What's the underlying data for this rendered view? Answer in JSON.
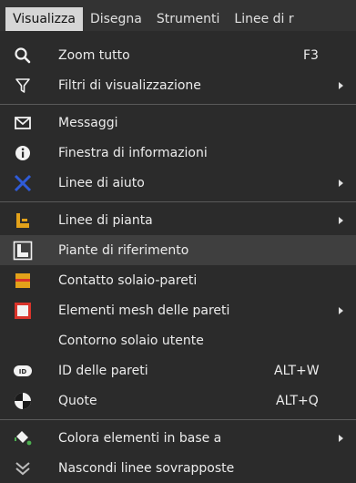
{
  "menubar": {
    "items": [
      "Visualizza",
      "Disegna",
      "Strumenti",
      "Linee di r"
    ]
  },
  "menu": {
    "items": [
      {
        "label": "Zoom tutto",
        "shortcut": "F3",
        "icon": "magnifier-icon"
      },
      {
        "label": "Filtri di visualizzazione",
        "submenu": true,
        "icon": "filter-funnel-icon"
      },
      {
        "label": "Messaggi",
        "icon": "envelope-icon"
      },
      {
        "label": "Finestra di informazioni",
        "icon": "info-icon"
      },
      {
        "label": "Linee di aiuto",
        "submenu": true,
        "icon": "blue-cross-icon"
      },
      {
        "label": "Linee di pianta",
        "submenu": true,
        "icon": "floor-plan-icon"
      },
      {
        "label": "Piante di riferimento",
        "icon": "reference-plan-icon"
      },
      {
        "label": "Contatto solaio-pareti",
        "icon": "slab-wall-contact-icon"
      },
      {
        "label": "Elementi mesh delle pareti",
        "submenu": true,
        "icon": "wall-mesh-icon"
      },
      {
        "label": "Contorno solaio utente",
        "icon": ""
      },
      {
        "label": "ID delle pareti",
        "shortcut": "ALT+W",
        "icon": "id-tag-icon"
      },
      {
        "label": "Quote",
        "shortcut": "ALT+Q",
        "icon": "dimension-target-icon"
      },
      {
        "label": "Colora elementi in base a",
        "submenu": true,
        "icon": "paint-bucket-icon"
      },
      {
        "label": "Nascondi linee sovrapposte",
        "icon": "double-chevron-icon"
      }
    ]
  },
  "colors": {
    "background": "#2b2b2b",
    "menubar_active_bg": "#d6d6d6",
    "highlight_row": "#3f3f3f",
    "accent_blue": "#2f5bd8",
    "accent_orange": "#e3a21a",
    "accent_red": "#d9342b"
  }
}
